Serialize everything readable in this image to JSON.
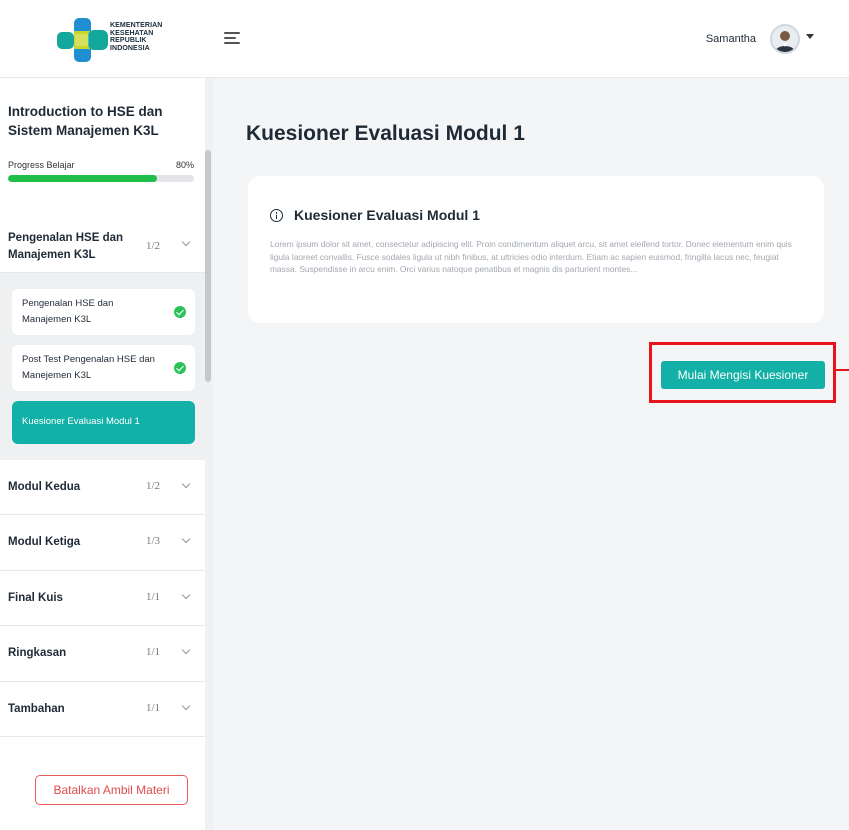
{
  "header": {
    "logo_lines": [
      "KEMENTERIAN",
      "KESEHATAN",
      "REPUBLIK",
      "INDONESIA"
    ],
    "user_name": "Samantha"
  },
  "sidebar": {
    "course_title": "Introduction to HSE dan Sistem Manajemen K3L",
    "progress_label": "Progress Belajar",
    "progress_percent_text": "80%",
    "progress_fraction": 0.8,
    "modules": [
      {
        "name": "Pengenalan HSE dan Manajemen K3L",
        "count": "1/2",
        "expanded": true
      },
      {
        "name": "Modul Kedua",
        "count": "1/2"
      },
      {
        "name": "Modul Ketiga",
        "count": "1/3"
      },
      {
        "name": "Final Kuis",
        "count": "1/1"
      },
      {
        "name": "Ringkasan",
        "count": "1/1"
      },
      {
        "name": "Tambahan",
        "count": "1/1"
      }
    ],
    "sub_items": [
      {
        "label": "Pengenalan HSE dan Manajemen K3L",
        "completed": true
      },
      {
        "label": "Post Test Pengenalan HSE dan Manejemen K3L",
        "completed": true
      },
      {
        "label": "Kuesioner Evaluasi Modul 1",
        "active": true
      }
    ],
    "cancel_label": "Batalkan Ambil Materi"
  },
  "main": {
    "page_title": "Kuesioner Evaluasi Modul 1",
    "card_title": "Kuesioner Evaluasi Modul 1",
    "card_body": "Lorem ipsum dolor sit amet, consectetur adipiscing elit. Proin condimentum aliquet arcu, sit amet eleifend tortor. Donec elementum enim quis ligula laoreet convallis. Fusce sodales ligula ut nibh finibus, at ultricies odio interdum. Etiam ac sapien euismod, fringilla lacus nec, feugiat massa. Suspendisse in arcu enim. Orci varius natoque penatibus et magnis dis parturient montes...",
    "start_button": "Mulai Mengisi Kuesioner"
  },
  "colors": {
    "accent": "#12b0a6",
    "progress": "#1fbf4a",
    "danger": "#e04c4c",
    "highlight": "#e8141c"
  }
}
